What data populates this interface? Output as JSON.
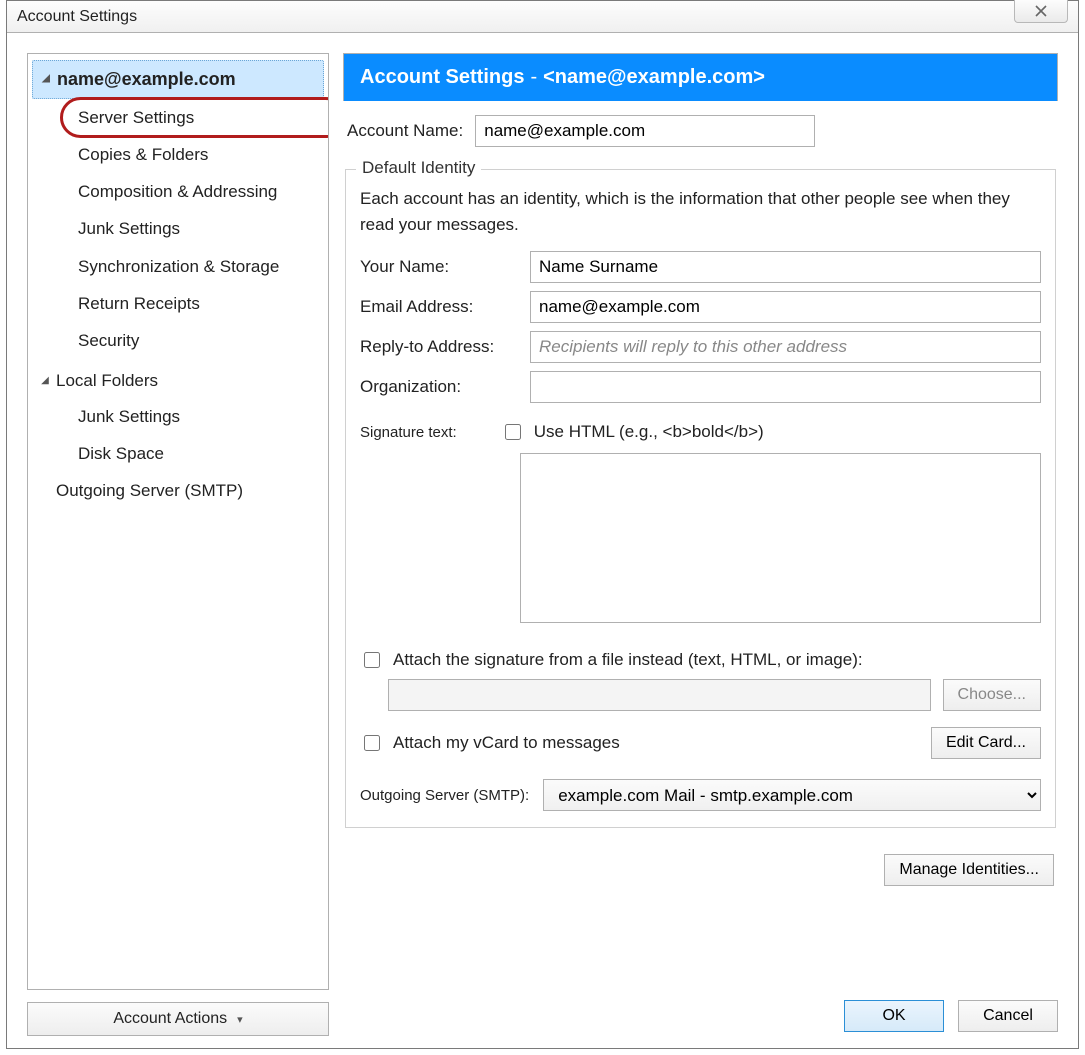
{
  "window": {
    "title": "Account Settings"
  },
  "sidebar": {
    "account_email": "name@example.com",
    "items": [
      "Server Settings",
      "Copies & Folders",
      "Composition & Addressing",
      "Junk Settings",
      "Synchronization & Storage",
      "Return Receipts",
      "Security"
    ],
    "local_folders_label": "Local Folders",
    "local_items": [
      "Junk Settings",
      "Disk Space"
    ],
    "outgoing_label": "Outgoing Server (SMTP)",
    "account_actions": "Account Actions"
  },
  "header": {
    "title": "Account Settings",
    "sep": "-",
    "subtitle": "<name@example.com>"
  },
  "fields": {
    "account_name_label": "Account Name:",
    "account_name_value": "name@example.com"
  },
  "identity": {
    "legend": "Default Identity",
    "desc": "Each account has an identity, which is the information that other people see when they read your messages.",
    "your_name_label": "Your Name:",
    "your_name_value": "Name Surname",
    "email_label": "Email Address:",
    "email_value": "name@example.com",
    "replyto_label": "Reply-to Address:",
    "replyto_placeholder": "Recipients will reply to this other address",
    "org_label": "Organization:",
    "sig_label": "Signature text:",
    "use_html_label": "Use HTML (e.g., <b>bold</b>)",
    "attach_file_label": "Attach the signature from a file instead (text, HTML, or image):",
    "choose_btn": "Choose...",
    "attach_vcard_label": "Attach my vCard to messages",
    "edit_card_btn": "Edit Card...",
    "smtp_label": "Outgoing Server (SMTP):",
    "smtp_value": "example.com Mail - smtp.example.com"
  },
  "buttons": {
    "manage_identities": "Manage Identities...",
    "ok": "OK",
    "cancel": "Cancel"
  }
}
